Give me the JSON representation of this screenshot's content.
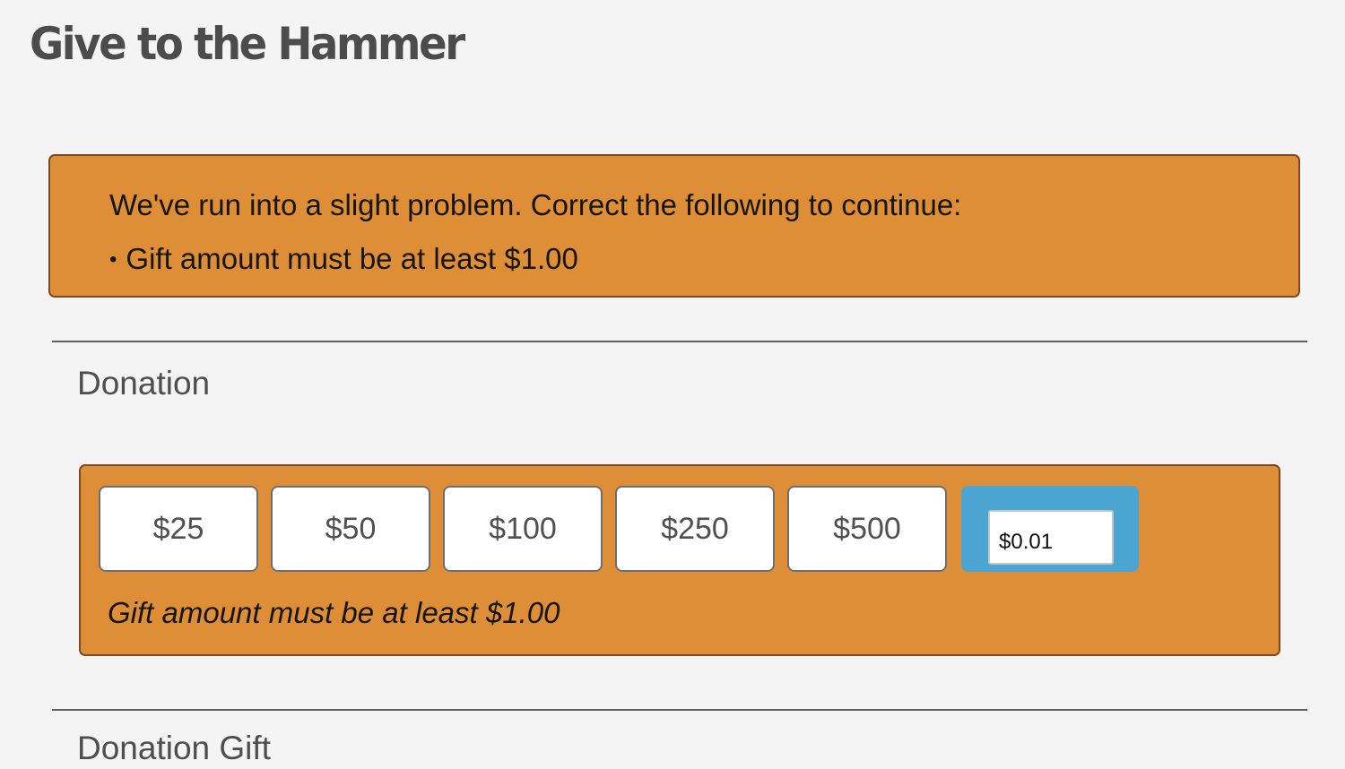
{
  "page": {
    "title": "Give to the Hammer"
  },
  "error_summary": {
    "heading": "We've run into a slight problem. Correct the following to continue:",
    "items": [
      {
        "bullet": "•",
        "text": "Gift amount must be at least $1.00"
      }
    ]
  },
  "donation_section": {
    "heading": "Donation",
    "amount_options": [
      "$25",
      "$50",
      "$100",
      "$250",
      "$500"
    ],
    "other_amount": {
      "value": "$0.01"
    },
    "field_error": "Gift amount must be at least $1.00"
  },
  "next_section": {
    "heading": "Donation Gift"
  },
  "colors": {
    "background": "#f4f4f4",
    "error_panel": "#de8e37",
    "error_border": "#7a4a22",
    "selected_amount": "#4ba4d2",
    "title_text": "#4c4c4c"
  }
}
